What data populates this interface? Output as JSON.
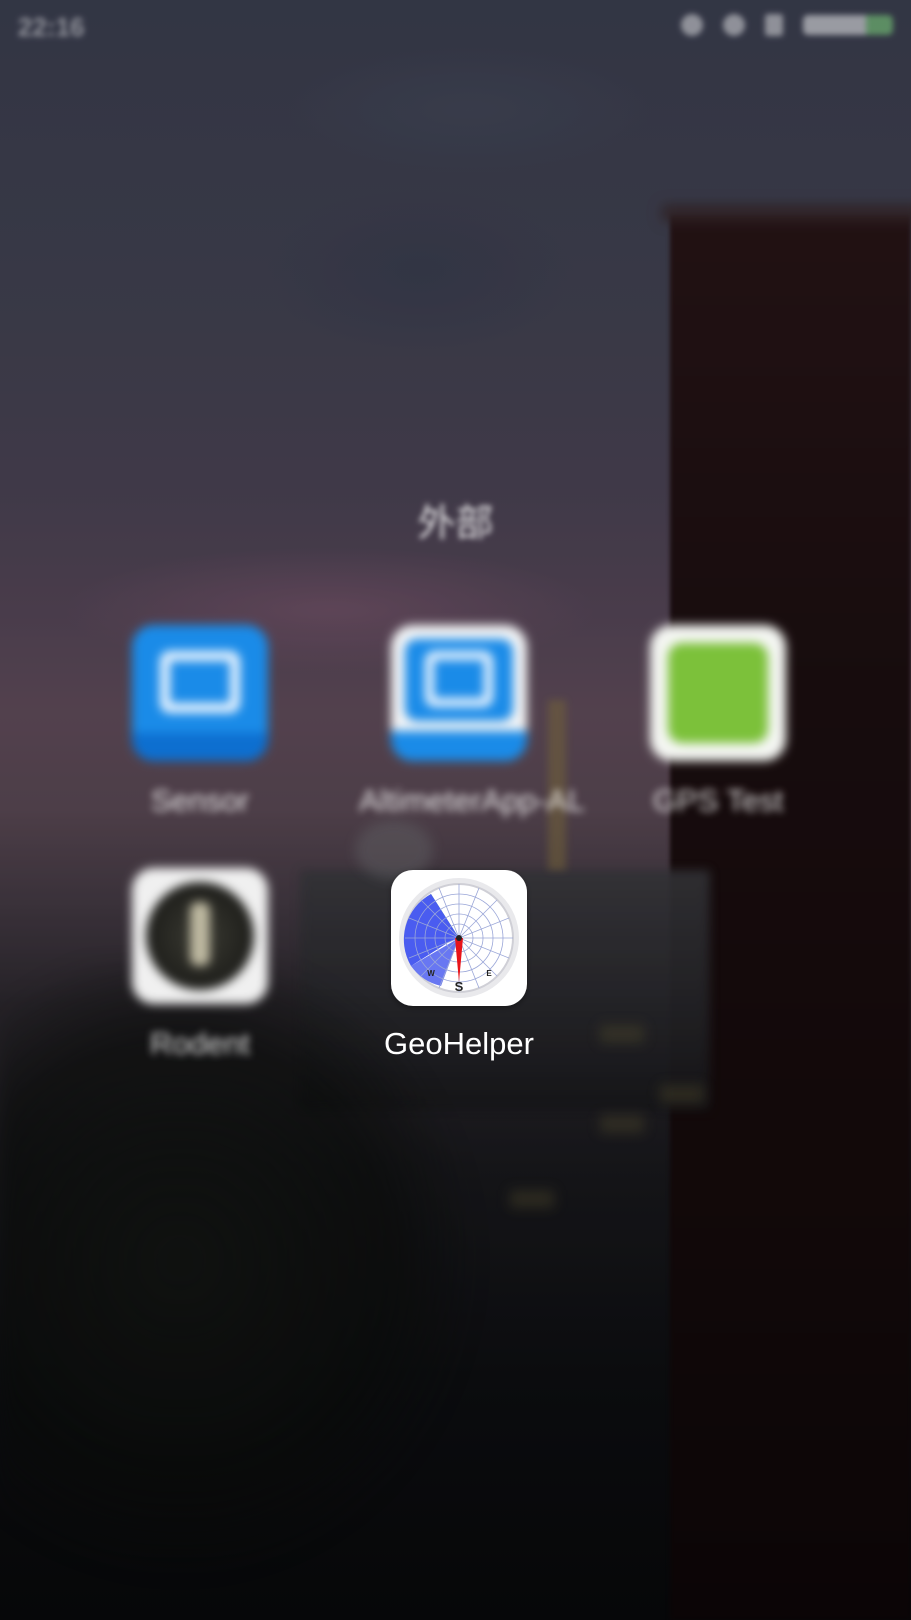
{
  "status_bar": {
    "time": "22:16"
  },
  "folder": {
    "title": "外部"
  },
  "apps": [
    {
      "label": "Sensor",
      "icon": "blue-sensor-icon"
    },
    {
      "label": "AltimeterApp-AL",
      "icon": "white-blue-app-icon"
    },
    {
      "label": "GPS Test",
      "icon": "green-android-icon"
    },
    {
      "label": "Rodent",
      "icon": "dark-circle-icon"
    },
    {
      "label": "GeoHelper",
      "icon": "compass-dial-icon"
    }
  ],
  "geohelper_icon": {
    "letters": {
      "south": "S",
      "west": "W",
      "east": "E"
    },
    "colors": {
      "plot_fill": "#4a5cf0",
      "plot_accent": "#5bc36a",
      "needle": "#e8141a",
      "grid": "#9aa6d8"
    }
  }
}
